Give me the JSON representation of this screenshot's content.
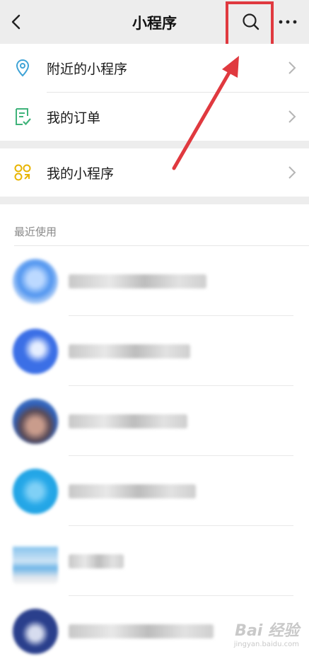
{
  "navbar": {
    "title": "小程序",
    "back_icon": "chevron-left-icon",
    "search_icon": "search-icon",
    "more_icon": "more-dots-icon"
  },
  "annotation": {
    "box_color": "#e0393f",
    "arrow_color": "#e0393f"
  },
  "menu": [
    {
      "label": "附近的小程序",
      "icon": "location-pin-icon",
      "icon_color": "#3fa3d6"
    },
    {
      "label": "我的订单",
      "icon": "order-checklist-icon",
      "icon_color": "#3fb37a"
    },
    {
      "label": "我的小程序",
      "icon": "mini-program-grid-icon",
      "icon_color": "#e8b400"
    }
  ],
  "recent": {
    "header": "最近使用",
    "items": [
      {
        "avatar_color": "#4f94ef"
      },
      {
        "avatar_color": "#3b6fe6"
      },
      {
        "avatar_color": "#2f5fb8"
      },
      {
        "avatar_color": "#26a8e8"
      },
      {
        "avatar_color": "#6fb6e8"
      },
      {
        "avatar_color": "#2a3f8c"
      }
    ]
  },
  "watermark": {
    "main": "Bai 经验",
    "sub": "jingyan.baidu.com"
  }
}
